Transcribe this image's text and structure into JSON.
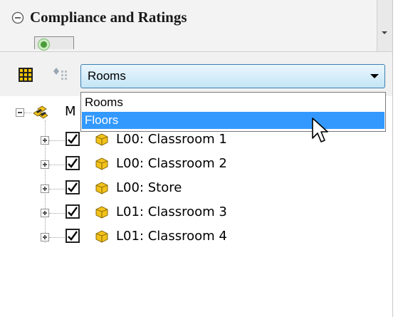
{
  "header": {
    "title": "Compliance and Ratings"
  },
  "toolbar": {
    "view_select": {
      "value": "Rooms",
      "options": [
        "Rooms",
        "Floors"
      ],
      "highlighted": "Floors"
    }
  },
  "tree": {
    "root_label": "M",
    "items": [
      {
        "label": "L00: Classroom 1",
        "checked": true
      },
      {
        "label": "L00: Classroom 2",
        "checked": true
      },
      {
        "label": "L00: Store",
        "checked": true
      },
      {
        "label": "L01: Classroom 3",
        "checked": true
      },
      {
        "label": "L01: Classroom 4",
        "checked": true
      }
    ]
  },
  "icons": {
    "collapse": "circle-minus-icon",
    "toggle": "toggle-switch-icon",
    "grid": "grid-icon",
    "filter": "filter-icon",
    "root": "building-icon",
    "room": "room-icon",
    "cursor": "mouse-pointer-icon"
  },
  "colors": {
    "selection": "#3399ff",
    "select_border": "#3c7fb1",
    "room_icon": "#f2c21b"
  }
}
